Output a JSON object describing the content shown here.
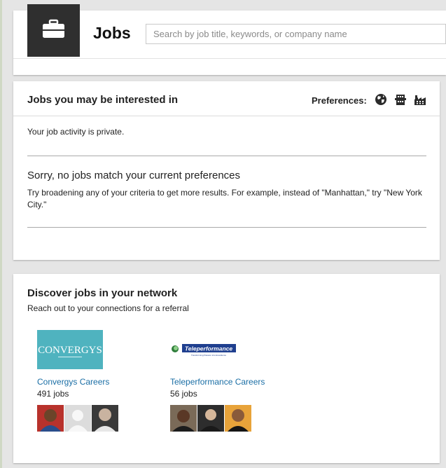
{
  "header": {
    "title": "Jobs",
    "search_placeholder": "Search by job title, keywords, or company name",
    "search_value": ""
  },
  "interest_panel": {
    "title": "Jobs you may be interested in",
    "preferences_label": "Preferences:",
    "preference_icons": [
      "globe-icon",
      "building-icon",
      "factory-icon"
    ],
    "privacy_note": "Your job activity is private.",
    "empty_title": "Sorry, no jobs match your current preferences",
    "empty_hint": "Try broadening any of your criteria to get more results. For example, instead of \"Manhattan,\" try \"New York City.\""
  },
  "network_panel": {
    "title": "Discover jobs in your network",
    "subtitle": "Reach out to your connections for a referral",
    "companies": [
      {
        "logo_text": "CONVERGYS",
        "logo_color": "#4fb3bf",
        "link_label": "Convergys Careers",
        "count_label": "491 jobs",
        "avatars": [
          "avatar",
          "avatar-placeholder",
          "avatar"
        ]
      },
      {
        "logo_text": "Teleperformance",
        "logo_tagline": "Transforming Passion into Excellence",
        "logo_color": "#1f3f8f",
        "link_label": "Teleperformance Careers",
        "count_label": "56 jobs",
        "avatars": [
          "avatar",
          "avatar",
          "avatar"
        ]
      }
    ]
  },
  "colors": {
    "link": "#1a6ea5",
    "background": "#e5e5e5",
    "logo_tile": "#2f2f2f"
  }
}
